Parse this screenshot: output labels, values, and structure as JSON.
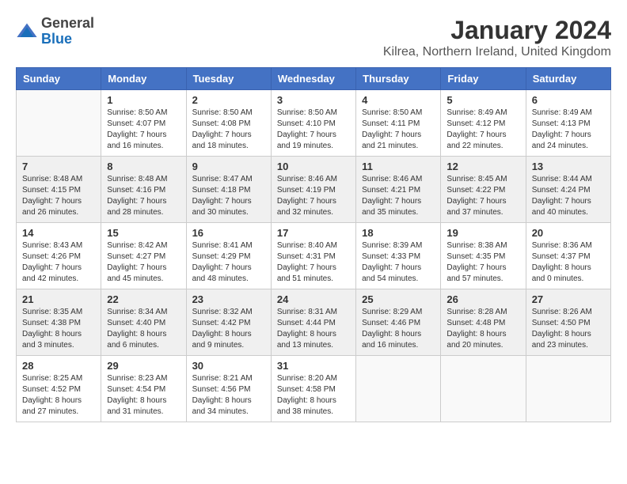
{
  "header": {
    "logo_line1": "General",
    "logo_line2": "Blue",
    "month": "January 2024",
    "location": "Kilrea, Northern Ireland, United Kingdom"
  },
  "days_of_week": [
    "Sunday",
    "Monday",
    "Tuesday",
    "Wednesday",
    "Thursday",
    "Friday",
    "Saturday"
  ],
  "weeks": [
    [
      {
        "num": "",
        "sunrise": "",
        "sunset": "",
        "daylight": ""
      },
      {
        "num": "1",
        "sunrise": "Sunrise: 8:50 AM",
        "sunset": "Sunset: 4:07 PM",
        "daylight": "Daylight: 7 hours and 16 minutes."
      },
      {
        "num": "2",
        "sunrise": "Sunrise: 8:50 AM",
        "sunset": "Sunset: 4:08 PM",
        "daylight": "Daylight: 7 hours and 18 minutes."
      },
      {
        "num": "3",
        "sunrise": "Sunrise: 8:50 AM",
        "sunset": "Sunset: 4:10 PM",
        "daylight": "Daylight: 7 hours and 19 minutes."
      },
      {
        "num": "4",
        "sunrise": "Sunrise: 8:50 AM",
        "sunset": "Sunset: 4:11 PM",
        "daylight": "Daylight: 7 hours and 21 minutes."
      },
      {
        "num": "5",
        "sunrise": "Sunrise: 8:49 AM",
        "sunset": "Sunset: 4:12 PM",
        "daylight": "Daylight: 7 hours and 22 minutes."
      },
      {
        "num": "6",
        "sunrise": "Sunrise: 8:49 AM",
        "sunset": "Sunset: 4:13 PM",
        "daylight": "Daylight: 7 hours and 24 minutes."
      }
    ],
    [
      {
        "num": "7",
        "sunrise": "Sunrise: 8:48 AM",
        "sunset": "Sunset: 4:15 PM",
        "daylight": "Daylight: 7 hours and 26 minutes."
      },
      {
        "num": "8",
        "sunrise": "Sunrise: 8:48 AM",
        "sunset": "Sunset: 4:16 PM",
        "daylight": "Daylight: 7 hours and 28 minutes."
      },
      {
        "num": "9",
        "sunrise": "Sunrise: 8:47 AM",
        "sunset": "Sunset: 4:18 PM",
        "daylight": "Daylight: 7 hours and 30 minutes."
      },
      {
        "num": "10",
        "sunrise": "Sunrise: 8:46 AM",
        "sunset": "Sunset: 4:19 PM",
        "daylight": "Daylight: 7 hours and 32 minutes."
      },
      {
        "num": "11",
        "sunrise": "Sunrise: 8:46 AM",
        "sunset": "Sunset: 4:21 PM",
        "daylight": "Daylight: 7 hours and 35 minutes."
      },
      {
        "num": "12",
        "sunrise": "Sunrise: 8:45 AM",
        "sunset": "Sunset: 4:22 PM",
        "daylight": "Daylight: 7 hours and 37 minutes."
      },
      {
        "num": "13",
        "sunrise": "Sunrise: 8:44 AM",
        "sunset": "Sunset: 4:24 PM",
        "daylight": "Daylight: 7 hours and 40 minutes."
      }
    ],
    [
      {
        "num": "14",
        "sunrise": "Sunrise: 8:43 AM",
        "sunset": "Sunset: 4:26 PM",
        "daylight": "Daylight: 7 hours and 42 minutes."
      },
      {
        "num": "15",
        "sunrise": "Sunrise: 8:42 AM",
        "sunset": "Sunset: 4:27 PM",
        "daylight": "Daylight: 7 hours and 45 minutes."
      },
      {
        "num": "16",
        "sunrise": "Sunrise: 8:41 AM",
        "sunset": "Sunset: 4:29 PM",
        "daylight": "Daylight: 7 hours and 48 minutes."
      },
      {
        "num": "17",
        "sunrise": "Sunrise: 8:40 AM",
        "sunset": "Sunset: 4:31 PM",
        "daylight": "Daylight: 7 hours and 51 minutes."
      },
      {
        "num": "18",
        "sunrise": "Sunrise: 8:39 AM",
        "sunset": "Sunset: 4:33 PM",
        "daylight": "Daylight: 7 hours and 54 minutes."
      },
      {
        "num": "19",
        "sunrise": "Sunrise: 8:38 AM",
        "sunset": "Sunset: 4:35 PM",
        "daylight": "Daylight: 7 hours and 57 minutes."
      },
      {
        "num": "20",
        "sunrise": "Sunrise: 8:36 AM",
        "sunset": "Sunset: 4:37 PM",
        "daylight": "Daylight: 8 hours and 0 minutes."
      }
    ],
    [
      {
        "num": "21",
        "sunrise": "Sunrise: 8:35 AM",
        "sunset": "Sunset: 4:38 PM",
        "daylight": "Daylight: 8 hours and 3 minutes."
      },
      {
        "num": "22",
        "sunrise": "Sunrise: 8:34 AM",
        "sunset": "Sunset: 4:40 PM",
        "daylight": "Daylight: 8 hours and 6 minutes."
      },
      {
        "num": "23",
        "sunrise": "Sunrise: 8:32 AM",
        "sunset": "Sunset: 4:42 PM",
        "daylight": "Daylight: 8 hours and 9 minutes."
      },
      {
        "num": "24",
        "sunrise": "Sunrise: 8:31 AM",
        "sunset": "Sunset: 4:44 PM",
        "daylight": "Daylight: 8 hours and 13 minutes."
      },
      {
        "num": "25",
        "sunrise": "Sunrise: 8:29 AM",
        "sunset": "Sunset: 4:46 PM",
        "daylight": "Daylight: 8 hours and 16 minutes."
      },
      {
        "num": "26",
        "sunrise": "Sunrise: 8:28 AM",
        "sunset": "Sunset: 4:48 PM",
        "daylight": "Daylight: 8 hours and 20 minutes."
      },
      {
        "num": "27",
        "sunrise": "Sunrise: 8:26 AM",
        "sunset": "Sunset: 4:50 PM",
        "daylight": "Daylight: 8 hours and 23 minutes."
      }
    ],
    [
      {
        "num": "28",
        "sunrise": "Sunrise: 8:25 AM",
        "sunset": "Sunset: 4:52 PM",
        "daylight": "Daylight: 8 hours and 27 minutes."
      },
      {
        "num": "29",
        "sunrise": "Sunrise: 8:23 AM",
        "sunset": "Sunset: 4:54 PM",
        "daylight": "Daylight: 8 hours and 31 minutes."
      },
      {
        "num": "30",
        "sunrise": "Sunrise: 8:21 AM",
        "sunset": "Sunset: 4:56 PM",
        "daylight": "Daylight: 8 hours and 34 minutes."
      },
      {
        "num": "31",
        "sunrise": "Sunrise: 8:20 AM",
        "sunset": "Sunset: 4:58 PM",
        "daylight": "Daylight: 8 hours and 38 minutes."
      },
      {
        "num": "",
        "sunrise": "",
        "sunset": "",
        "daylight": ""
      },
      {
        "num": "",
        "sunrise": "",
        "sunset": "",
        "daylight": ""
      },
      {
        "num": "",
        "sunrise": "",
        "sunset": "",
        "daylight": ""
      }
    ]
  ]
}
